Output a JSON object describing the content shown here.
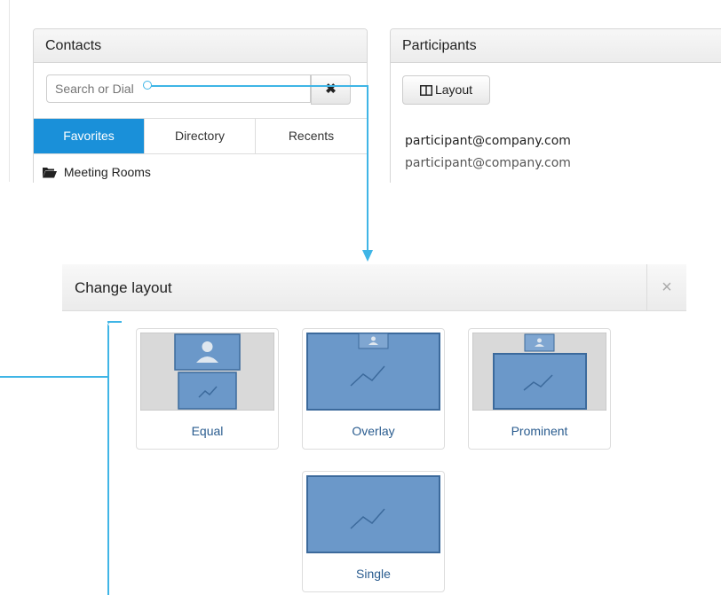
{
  "contacts": {
    "title": "Contacts",
    "search_placeholder": "Search or Dial",
    "clear_label": "✖",
    "tabs": [
      {
        "label": "Favorites",
        "active": true
      },
      {
        "label": "Directory",
        "active": false
      },
      {
        "label": "Recents",
        "active": false
      }
    ],
    "folder": {
      "label": "Meeting Rooms",
      "icon": "folder-open-icon"
    }
  },
  "participants": {
    "title": "Participants",
    "layout_button": "Layout",
    "name": "participant@company.com",
    "address": "participant@company.com"
  },
  "dialog": {
    "title": "Change layout",
    "close_label": "×",
    "options": [
      {
        "label": "Equal",
        "icon": "equal-layout-icon"
      },
      {
        "label": "Overlay",
        "icon": "overlay-layout-icon"
      },
      {
        "label": "Prominent",
        "icon": "prominent-layout-icon"
      },
      {
        "label": "Single",
        "icon": "single-layout-icon"
      }
    ]
  },
  "colors": {
    "accent": "#1a90d9",
    "connector": "#3fb5e6",
    "tile_fill": "#6b98c9",
    "tile_border": "#3c6a9c",
    "label": "#2a5c8f"
  }
}
